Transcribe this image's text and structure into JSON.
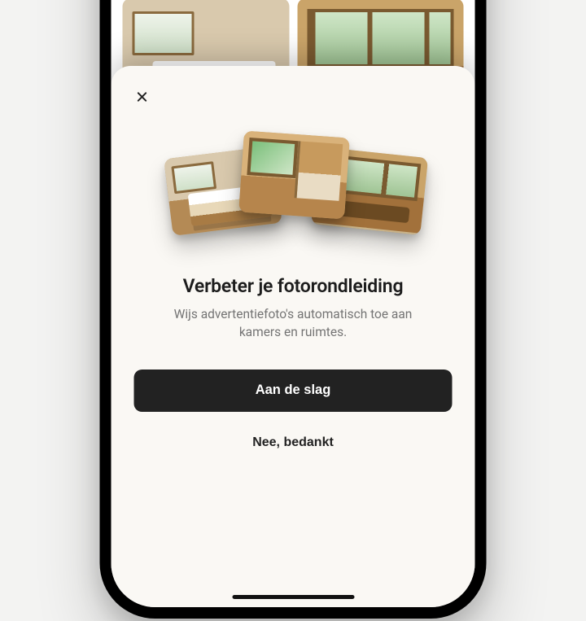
{
  "modal": {
    "title": "Verbeter je fotorondleiding",
    "subtitle": "Wijs advertentiefoto's automatisch toe aan kamers en ruimtes.",
    "primary_label": "Aan de slag",
    "secondary_label": "Nee, bedankt",
    "close_icon": "close-icon"
  },
  "collage": {
    "cards": [
      "bedroom",
      "kitchen",
      "living-room"
    ]
  },
  "background_gallery": {
    "thumbs": [
      "bedroom",
      "living-room"
    ]
  }
}
